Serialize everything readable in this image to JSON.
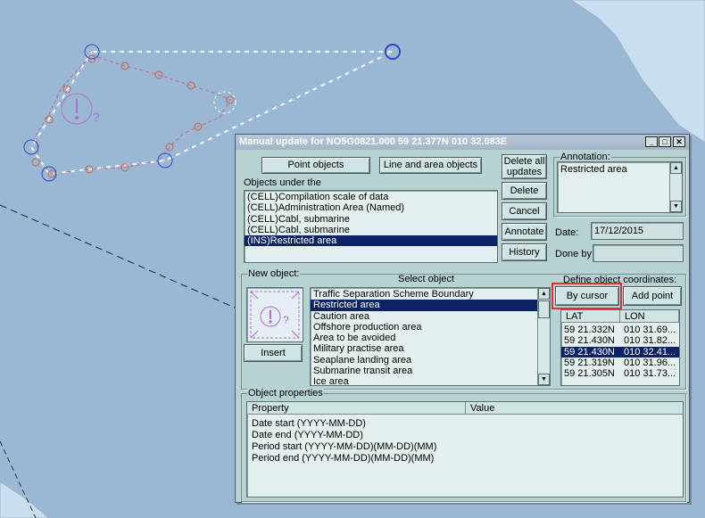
{
  "dialog": {
    "title": "Manual update for NO5G0821.000  59 21.377N  010 32.083E",
    "tabs": {
      "point": "Point objects",
      "line_area": "Line and area objects"
    },
    "objects_under_label": "Objects under the",
    "objects_under": [
      "(CELL)Compilation scale of data",
      "(CELL)Administration Area (Named)",
      "(CELL)Cabl, submarine",
      "(CELL)Cabl, submarine",
      "(INS)Restricted area"
    ],
    "buttons": {
      "delete_all": "Delete all updates",
      "delete": "Delete",
      "cancel": "Cancel",
      "annotate": "Annotate",
      "history": "History",
      "insert": "Insert",
      "by_cursor": "By cursor",
      "add_point": "Add point"
    },
    "annotation_label": "Annotation:",
    "annotation_value": "Restricted area",
    "date_label": "Date:",
    "date_value": "17/12/2015",
    "done_by_label": "Done by:",
    "done_by_value": "",
    "new_object_label": "New object:",
    "select_object_label": "Select object",
    "select_objects": [
      "Traffic Separation Scheme  Boundary",
      "Restricted area",
      "Caution area",
      "Offshore production area",
      "Area to be avoided",
      "Military practise area",
      "Seaplane landing area",
      "Submarine transit area",
      "Ice area"
    ],
    "define_coords_label": "Define object coordinates:",
    "coords_headers": {
      "lat": "LAT",
      "lon": "LON"
    },
    "coords": [
      {
        "lat": "59 21.332N",
        "lon": "010 31.69..."
      },
      {
        "lat": "59 21.430N",
        "lon": "010 31.82..."
      },
      {
        "lat": "59 21.430N",
        "lon": "010 32.41..."
      },
      {
        "lat": "59 21.319N",
        "lon": "010 31.96..."
      },
      {
        "lat": "59 21.305N",
        "lon": "010 31.73..."
      }
    ],
    "object_properties_label": "Object properties",
    "props_headers": {
      "property": "Property",
      "value": "Value"
    },
    "properties": [
      "Date start (YYYY-MM-DD)",
      "Date end (YYYY-MM-DD)",
      "Period start (YYYY-MM-DD)(MM-DD)(MM)",
      "Period end (YYYY-MM-DD)(MM-DD)(MM)"
    ]
  },
  "colors": {
    "sea": "#9ab8d4",
    "land": "#c9dff0",
    "dialog_bg": "#b6d2d2",
    "selection": "#0c2366",
    "highlight_box": "#e03030",
    "drawing_blue": "#3344cc",
    "symbol_purple": "#b070d0"
  }
}
